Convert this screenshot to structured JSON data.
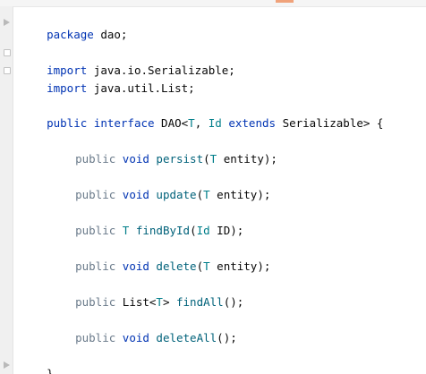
{
  "editor": {
    "lines": {
      "package": {
        "kw": "package",
        "rest": " dao;"
      },
      "import1": {
        "kw": "import",
        "rest": " java.io.Serializable;"
      },
      "import2": {
        "kw": "import",
        "rest": " java.util.List;"
      },
      "iface": {
        "kw_public": "public",
        "kw_interface": " interface",
        "name": " DAO<",
        "type_t": "T",
        "comma": ", ",
        "type_id": "Id",
        "kw_extends": " extends",
        "rest": " Serializable> {"
      },
      "persist": {
        "kw_public": "public",
        "kw_void": " void",
        "fn": " persist",
        "open": "(",
        "type": "T",
        "rest": " entity);"
      },
      "update": {
        "kw_public": "public",
        "kw_void": " void",
        "fn": " update",
        "open": "(",
        "type": "T",
        "rest": " entity);"
      },
      "findById": {
        "kw_public": "public",
        "ret": " T",
        "fn": " findById",
        "open": "(",
        "type": "Id",
        "rest": " ID);"
      },
      "delete": {
        "kw_public": "public",
        "kw_void": " void",
        "fn": " delete",
        "open": "(",
        "type": "T",
        "rest": " entity);"
      },
      "findAll": {
        "kw_public": "public",
        "ret_pre": " List<",
        "ret_t": "T",
        "ret_post": ">",
        "fn": " findAll",
        "rest": "();"
      },
      "deleteAll": {
        "kw_public": "public",
        "kw_void": " void",
        "fn": " deleteAll",
        "rest": "();"
      },
      "close": {
        "rest": "}"
      }
    }
  },
  "colors": {
    "keyword": "#0033b3",
    "type_param": "#007e8a",
    "method": "#00627a",
    "text": "#080808"
  }
}
